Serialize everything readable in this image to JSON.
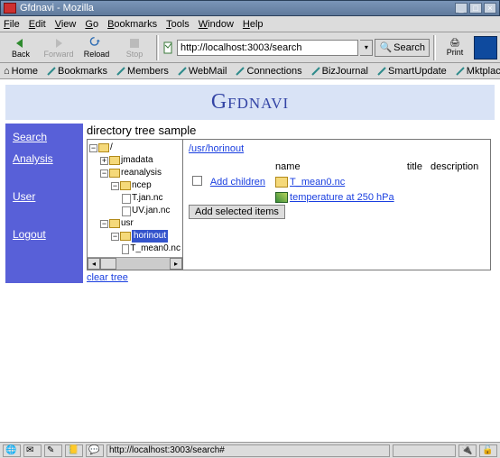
{
  "window_title": "Gfdnavi - Mozilla",
  "menu": [
    "File",
    "Edit",
    "View",
    "Go",
    "Bookmarks",
    "Tools",
    "Window",
    "Help"
  ],
  "toolbar": {
    "back": "Back",
    "forward": "Forward",
    "reload": "Reload",
    "stop": "Stop",
    "search": "Search",
    "print": "Print"
  },
  "url": "http://localhost:3003/search",
  "bookmarks": [
    "Home",
    "Bookmarks",
    "Members",
    "WebMail",
    "Connections",
    "BizJournal",
    "SmartUpdate",
    "Mktplace"
  ],
  "app_title": "Gfdnavi",
  "sidebar": {
    "search": "Search",
    "analysis": "Analysis",
    "user": "User",
    "logout": "Logout"
  },
  "page_heading": "directory tree sample",
  "tree": {
    "root": "/",
    "jmadata": "jmadata",
    "reanalysis": "reanalysis",
    "ncep": "ncep",
    "tjan": "T.jan.nc",
    "uvjan": "UV.jan.nc",
    "usr": "usr",
    "horinout": "horinout",
    "tmean": "T_mean0.nc"
  },
  "clear_tree": "clear tree",
  "right": {
    "path": "/usr/horinout",
    "headers": {
      "name": "name",
      "title": "title",
      "description": "description"
    },
    "add_children": "Add children",
    "row1": "T_mean0.nc",
    "row2": "temperature at 250 hPa",
    "add_selected": "Add selected items"
  },
  "status_url": "http://localhost:3003/search#"
}
